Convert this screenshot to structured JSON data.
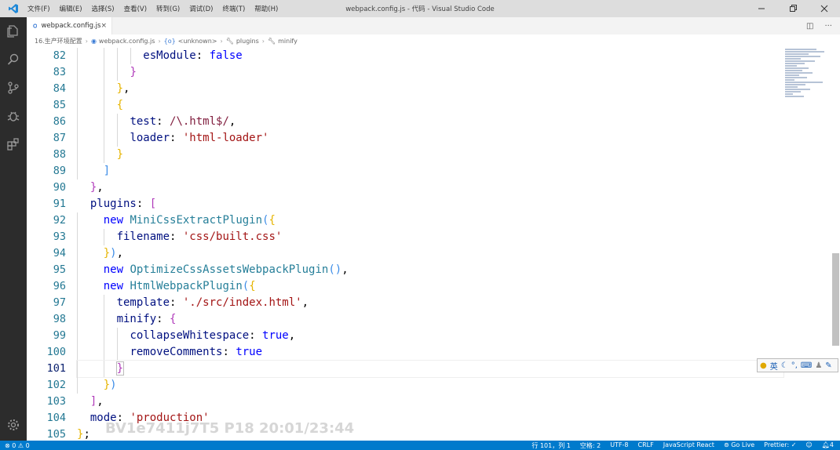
{
  "window": {
    "title": "webpack.config.js - 代码 - Visual Studio Code",
    "menu": [
      "文件(F)",
      "编辑(E)",
      "选择(S)",
      "查看(V)",
      "转到(G)",
      "调试(D)",
      "终端(T)",
      "帮助(H)"
    ]
  },
  "tab": {
    "label": "webpack.config.js",
    "close": "×"
  },
  "breadcrumb": [
    "16.生产环境配置",
    "webpack.config.js",
    "<unknown>",
    "plugins",
    "minify"
  ],
  "editor": {
    "line_numbers": [
      "82",
      "83",
      "84",
      "85",
      "86",
      "87",
      "88",
      "89",
      "90",
      "91",
      "92",
      "93",
      "94",
      "95",
      "96",
      "97",
      "98",
      "99",
      "100",
      "101",
      "102",
      "103",
      "104",
      "105"
    ],
    "current_line": "101"
  },
  "watermark": "BV1e7411j7T5 P18 20:01/23:44",
  "ime_bar": "英",
  "status": {
    "errors": "0",
    "warnings": "0",
    "position": "行 101，列 1",
    "spaces": "空格: 2",
    "encoding": "UTF-8",
    "eol": "CRLF",
    "language": "JavaScript React",
    "golive": "Go Live",
    "prettier": "Prettier: ✓",
    "notifications": "4"
  },
  "colors": {
    "statusbar": "#007acc",
    "activitybar": "#2c2c2c",
    "titlebar": "#dddddd"
  }
}
